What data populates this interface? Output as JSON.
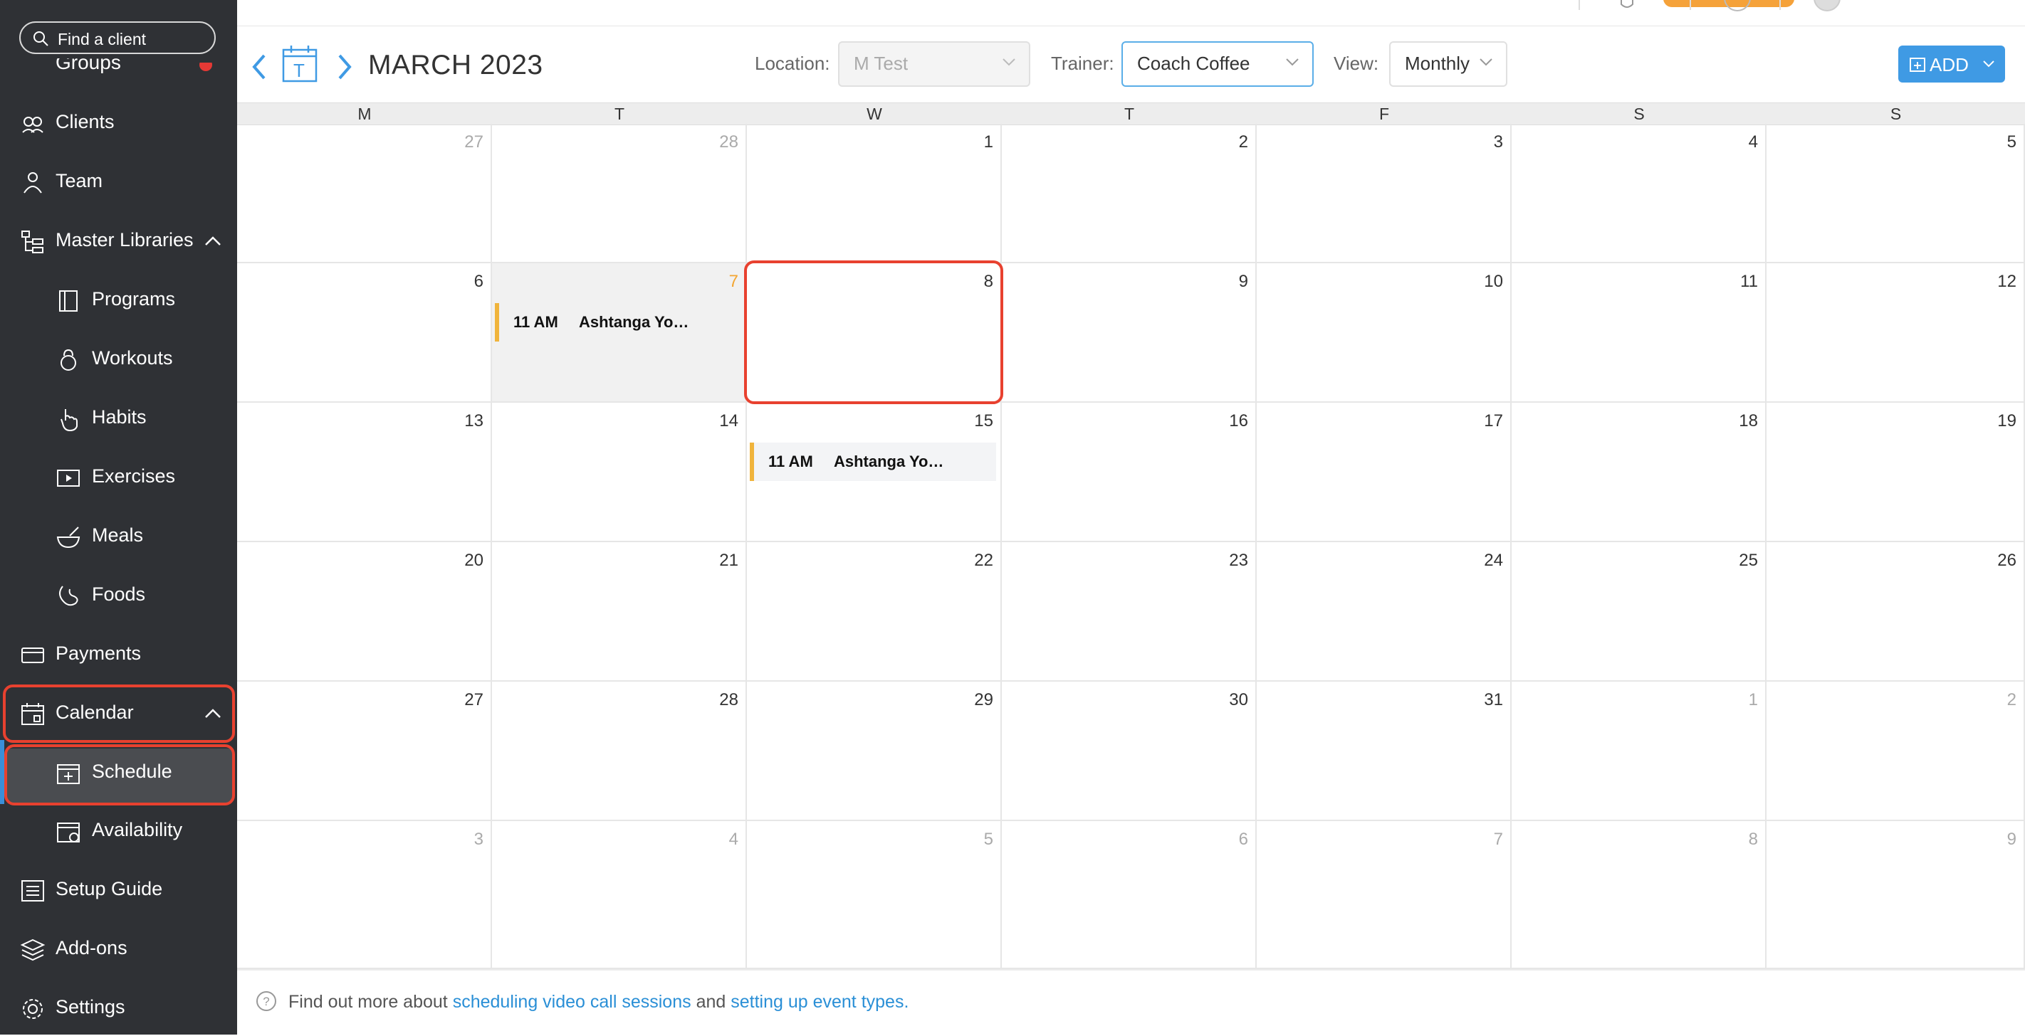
{
  "search": {
    "placeholder": "Find a client"
  },
  "sidebar": {
    "items": [
      {
        "label": "Clients",
        "icon": "clients-icon"
      },
      {
        "label": "Team",
        "icon": "team-icon"
      },
      {
        "label": "Master Libraries",
        "icon": "libraries-icon"
      },
      {
        "label": "Programs",
        "icon": "programs-icon"
      },
      {
        "label": "Workouts",
        "icon": "kettlebell-icon"
      },
      {
        "label": "Habits",
        "icon": "habits-icon"
      },
      {
        "label": "Exercises",
        "icon": "play-icon"
      },
      {
        "label": "Meals",
        "icon": "meals-icon"
      },
      {
        "label": "Foods",
        "icon": "foods-icon"
      },
      {
        "label": "Payments",
        "icon": "payments-icon"
      },
      {
        "label": "Calendar",
        "icon": "calendar-icon"
      },
      {
        "label": "Schedule",
        "icon": "schedule-icon"
      },
      {
        "label": "Availability",
        "icon": "availability-icon"
      },
      {
        "label": "Setup Guide",
        "icon": "setup-guide-icon"
      },
      {
        "label": "Add-ons",
        "icon": "addons-icon"
      },
      {
        "label": "Settings",
        "icon": "settings-icon"
      }
    ],
    "active": "Schedule",
    "highlight_color": "#e8412f"
  },
  "header": {
    "month": "MARCH 2023",
    "today_glyph": "T",
    "location_label": "Location:",
    "location_value": "M Test",
    "trainer_label": "Trainer:",
    "trainer_value": "Coach Coffee",
    "view_label": "View:",
    "view_value": "Monthly",
    "add_label": "ADD"
  },
  "calendar": {
    "weekdays": [
      "M",
      "T",
      "W",
      "T",
      "F",
      "S",
      "S"
    ],
    "weeks": [
      [
        {
          "d": "27",
          "o": true
        },
        {
          "d": "28",
          "o": true
        },
        {
          "d": "1"
        },
        {
          "d": "2"
        },
        {
          "d": "3"
        },
        {
          "d": "4"
        },
        {
          "d": "5"
        }
      ],
      [
        {
          "d": "6"
        },
        {
          "d": "7",
          "today": true,
          "event": {
            "time": "11 AM",
            "name": "Ashtanga Yo…"
          }
        },
        {
          "d": "8",
          "selected": true
        },
        {
          "d": "9"
        },
        {
          "d": "10"
        },
        {
          "d": "11"
        },
        {
          "d": "12"
        }
      ],
      [
        {
          "d": "13"
        },
        {
          "d": "14"
        },
        {
          "d": "15",
          "event": {
            "time": "11 AM",
            "name": "Ashtanga Yo…"
          }
        },
        {
          "d": "16"
        },
        {
          "d": "17"
        },
        {
          "d": "18"
        },
        {
          "d": "19"
        }
      ],
      [
        {
          "d": "20"
        },
        {
          "d": "21"
        },
        {
          "d": "22"
        },
        {
          "d": "23"
        },
        {
          "d": "24"
        },
        {
          "d": "25"
        },
        {
          "d": "26"
        }
      ],
      [
        {
          "d": "27"
        },
        {
          "d": "28"
        },
        {
          "d": "29"
        },
        {
          "d": "30"
        },
        {
          "d": "31"
        },
        {
          "d": "1",
          "o": true
        },
        {
          "d": "2",
          "o": true
        }
      ],
      [
        {
          "d": "3",
          "o": true
        },
        {
          "d": "4",
          "o": true
        },
        {
          "d": "5",
          "o": true
        },
        {
          "d": "6",
          "o": true
        },
        {
          "d": "7",
          "o": true
        },
        {
          "d": "8",
          "o": true
        },
        {
          "d": "9",
          "o": true
        }
      ]
    ],
    "today_color": "#f3a632",
    "event_color": "#f0b43c"
  },
  "footer": {
    "prefix": "Find out more about ",
    "link1": "scheduling video call sessions",
    "middle": " and ",
    "link2": "setting up event types."
  }
}
